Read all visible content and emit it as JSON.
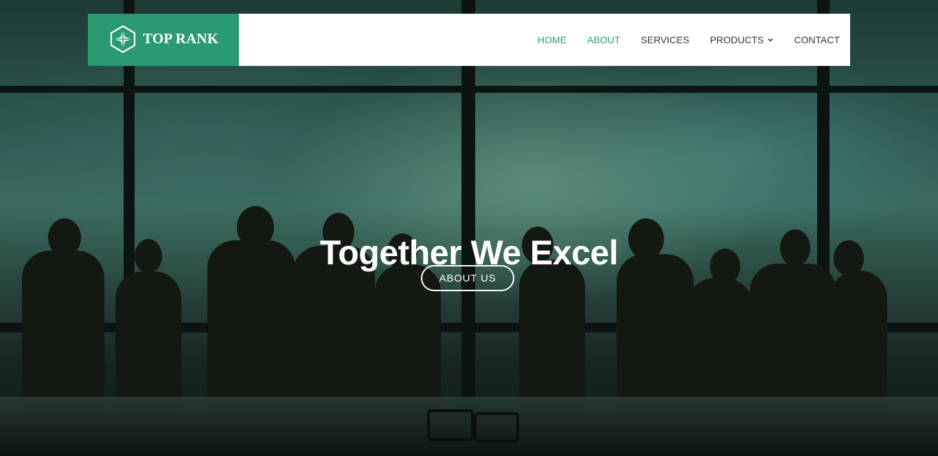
{
  "brand": {
    "name": "TOP RANK",
    "color": "#2a9a73",
    "logo_icon": "compass-star-icon"
  },
  "nav": {
    "items": [
      {
        "label": "HOME",
        "active": true
      },
      {
        "label": "ABOUT",
        "active": true
      },
      {
        "label": "SERVICES",
        "active": false
      },
      {
        "label": "PRODUCTS",
        "active": false,
        "has_dropdown": true,
        "icon": "chevron-down-icon"
      },
      {
        "label": "CONTACT",
        "active": false
      }
    ]
  },
  "hero": {
    "title": "Together We Excel",
    "cta_label": "ABOUT US",
    "background": "office-team-silhouette-city-view"
  }
}
